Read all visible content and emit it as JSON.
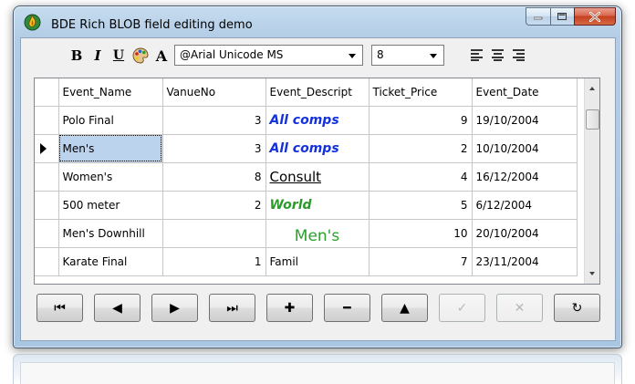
{
  "window": {
    "title": "BDE Rich BLOB field editing demo",
    "accent_color": "#b3cde6",
    "caption_buttons": [
      {
        "name": "minimize",
        "glyph": "—"
      },
      {
        "name": "maximize",
        "glyph": "▢"
      },
      {
        "name": "close",
        "glyph": "X"
      }
    ]
  },
  "toolbar": {
    "bold_label": "B",
    "italic_label": "I",
    "underline_label": "U",
    "color_icon": "palette-icon",
    "font_label": "A",
    "font_name": "@Arial Unicode MS",
    "font_size": "8",
    "align_left_icon": "align-left-icon",
    "align_center_icon": "align-center-icon",
    "align_right_icon": "align-right-icon"
  },
  "grid": {
    "columns": [
      "Event_Name",
      "VanueNo",
      "Event_Descript",
      "Ticket_Price",
      "Event_Date"
    ],
    "rows": [
      {
        "event_name": "Polo Final",
        "venue_no": "3",
        "descript": "All comps",
        "descript_style": "blue",
        "price": "9",
        "date": "19/10/2004"
      },
      {
        "event_name": "Men's",
        "venue_no": "3",
        "descript": "All comps",
        "descript_style": "blue",
        "price": "2",
        "date": "10/10/2004"
      },
      {
        "event_name": "Women's",
        "venue_no": "8",
        "descript": "Consult",
        "descript_style": "consult",
        "price": "4",
        "date": "16/12/2004"
      },
      {
        "event_name": "500 meter",
        "venue_no": "2",
        "descript": "World",
        "descript_style": "green",
        "price": "5",
        "date": "6/12/2004"
      },
      {
        "event_name": "Men's Downhill",
        "venue_no": "",
        "descript": "Men's",
        "descript_style": "mens",
        "price": "10",
        "date": "20/10/2004"
      },
      {
        "event_name": "Karate Final",
        "venue_no": "1",
        "descript": "Famil",
        "descript_style": "plain",
        "price": "7",
        "date": "23/11/2004"
      }
    ],
    "current_row": 1
  },
  "navigator": {
    "buttons": [
      {
        "name": "first",
        "glyph": "⏮"
      },
      {
        "name": "prior",
        "glyph": "◀"
      },
      {
        "name": "next",
        "glyph": "▶"
      },
      {
        "name": "last",
        "glyph": "⏭"
      },
      {
        "name": "insert",
        "glyph": "✚"
      },
      {
        "name": "delete",
        "glyph": "━"
      },
      {
        "name": "edit",
        "glyph": "▲"
      },
      {
        "name": "post",
        "glyph": "✓"
      },
      {
        "name": "cancel",
        "glyph": "✕"
      },
      {
        "name": "refresh",
        "glyph": "↻"
      }
    ]
  }
}
